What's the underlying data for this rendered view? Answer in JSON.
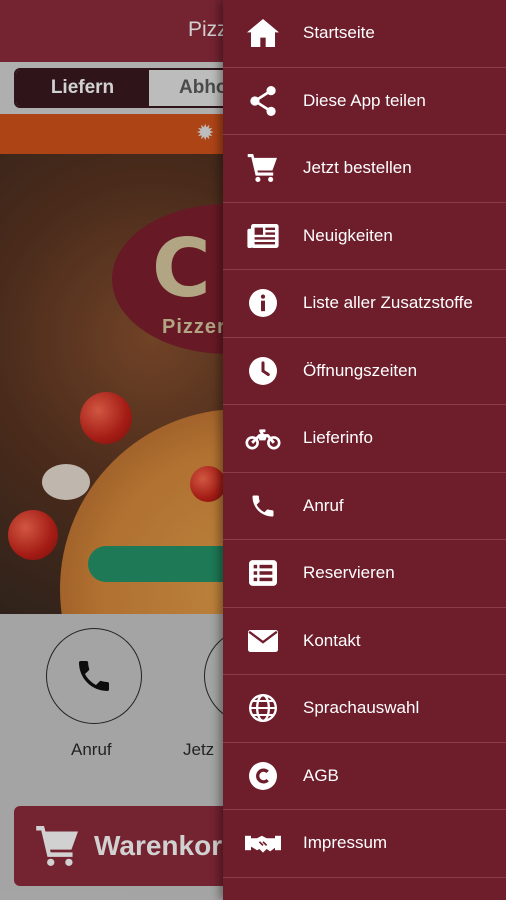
{
  "header": {
    "title": "Pizz"
  },
  "order_mode": {
    "active_label": "Liefern",
    "inactive_label": "Abho"
  },
  "logo": {
    "letter": "C",
    "subtitle": "Pizzer"
  },
  "quick_actions": [
    {
      "label": "Anruf",
      "icon": "phone-icon"
    },
    {
      "label": "Jetz",
      "icon": "order-icon"
    }
  ],
  "cart": {
    "label": "Warenkor",
    "icon": "cart-icon"
  },
  "drawer": {
    "items": [
      {
        "label": "Startseite",
        "icon": "home-icon"
      },
      {
        "label": "Diese App teilen",
        "icon": "share-icon"
      },
      {
        "label": "Jetzt bestellen",
        "icon": "cart-icon"
      },
      {
        "label": "Neuigkeiten",
        "icon": "newspaper-icon"
      },
      {
        "label": "Liste aller Zusatzstoffe",
        "icon": "info-icon"
      },
      {
        "label": "Öffnungszeiten",
        "icon": "clock-icon"
      },
      {
        "label": "Lieferinfo",
        "icon": "motorcycle-icon"
      },
      {
        "label": "Anruf",
        "icon": "phone-icon"
      },
      {
        "label": "Reservieren",
        "icon": "list-icon"
      },
      {
        "label": "Kontakt",
        "icon": "envelope-icon"
      },
      {
        "label": "Sprachauswahl",
        "icon": "globe-icon"
      },
      {
        "label": "AGB",
        "icon": "copyright-icon"
      },
      {
        "label": "Impressum",
        "icon": "handshake-icon"
      }
    ]
  },
  "colors": {
    "brand": "#8e2b3c",
    "drawer": "#6e1d2b",
    "accent_orange": "#d4541c",
    "green": "#24946a"
  }
}
